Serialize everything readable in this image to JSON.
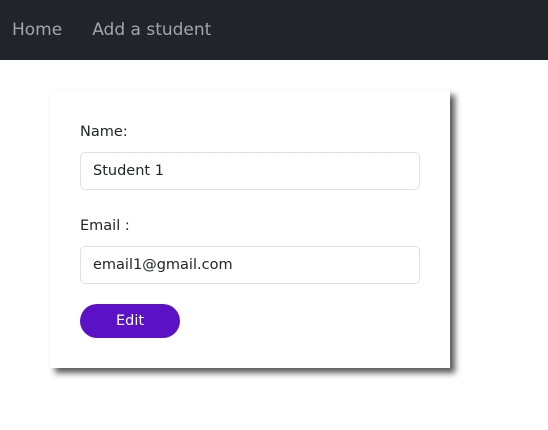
{
  "navbar": {
    "links": [
      {
        "label": "Home"
      },
      {
        "label": "Add a student"
      }
    ]
  },
  "form": {
    "name_label": "Name:",
    "name_value": "Student 1",
    "email_label": "Email :",
    "email_value": "email1@gmail.com",
    "submit_label": "Edit"
  },
  "colors": {
    "navbar_bg": "#212529",
    "nav_link": "#a3a5a8",
    "button_bg": "#5b12c7"
  }
}
